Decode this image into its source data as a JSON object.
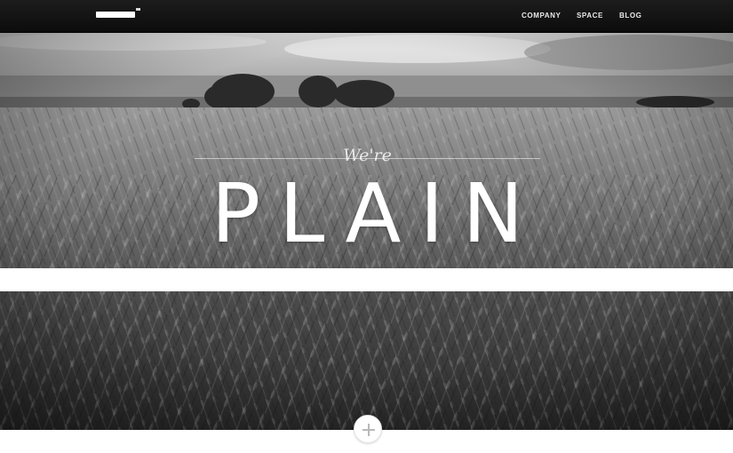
{
  "header": {
    "logo_icon": "logo-mark-icon",
    "nav": [
      {
        "label": "COMPANY"
      },
      {
        "label": "SPACE"
      },
      {
        "label": "BLOG"
      }
    ]
  },
  "hero": {
    "tagline": "We're",
    "headline": "PLAIN",
    "background": "black-and-white wheat field photo"
  },
  "footer": {
    "more_icon": "plus-icon"
  },
  "colors": {
    "topbar": "#111111",
    "text": "#ffffff",
    "nav_text": "#e9e9e9"
  }
}
